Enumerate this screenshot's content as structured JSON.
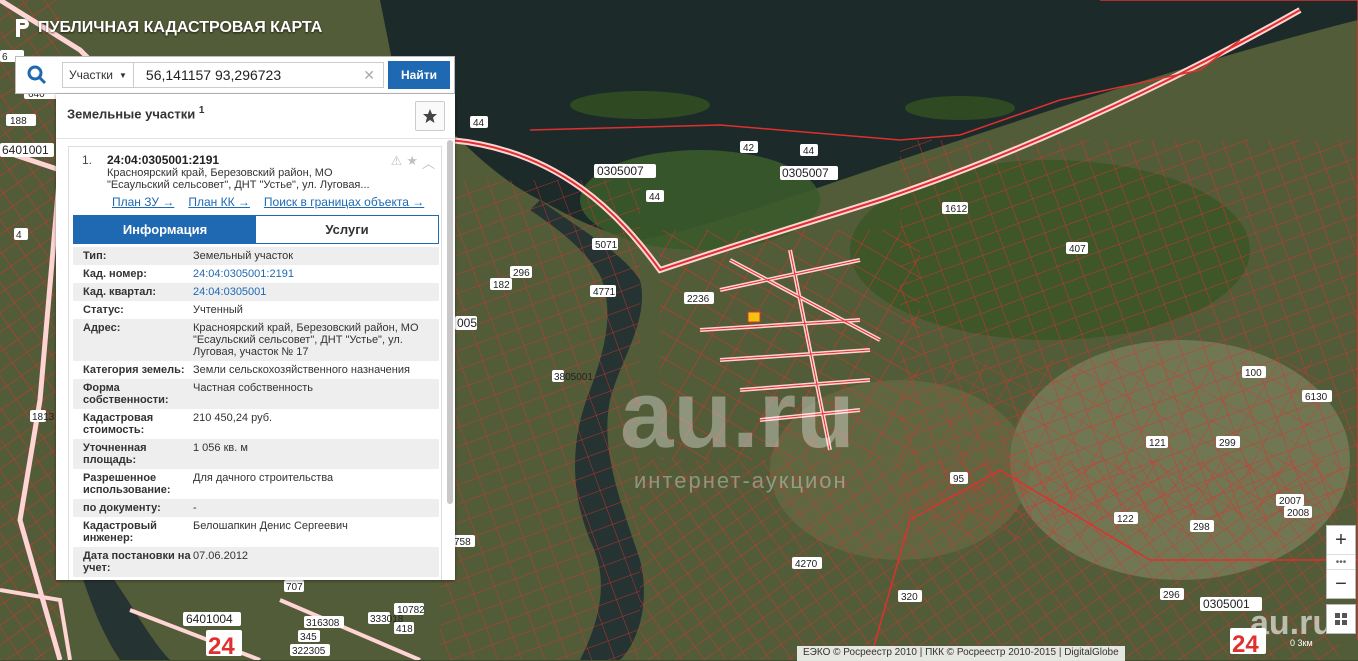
{
  "header": {
    "title": "ПУБЛИЧНАЯ КАДАСТРОВАЯ КАРТА"
  },
  "search": {
    "type_label": "Участки",
    "value": "56,141157 93,296723",
    "find_label": "Найти"
  },
  "panel": {
    "title": "Земельные участки",
    "count": "1",
    "item": {
      "index": "1.",
      "cad_number": "24:04:0305001:2191",
      "address": "Красноярский край, Березовский район, МО \"Есаульский сельсовет\", ДНТ \"Устье\", ул. Луговая...",
      "links": [
        "План ЗУ →",
        "План КК →",
        "Поиск в границах объекта →"
      ],
      "tabs": [
        "Информация",
        "Услуги"
      ],
      "rows": [
        {
          "k": "Тип:",
          "v": "Земельный участок"
        },
        {
          "k": "Кад. номер:",
          "v": "24:04:0305001:2191",
          "link": true
        },
        {
          "k": "Кад. квартал:",
          "v": "24:04:0305001",
          "link": true
        },
        {
          "k": "Статус:",
          "v": "Учтенный"
        },
        {
          "k": "Адрес:",
          "v": "Красноярский край, Березовский район, МО \"Есаульский сельсовет\", ДНТ \"Устье\", ул. Луговая, участок № 17"
        },
        {
          "k": "Категория земель:",
          "v": "Земли сельскохозяйственного назначения"
        },
        {
          "k": "Форма собственности:",
          "v": "Частная собственность"
        },
        {
          "k": "Кадастровая стоимость:",
          "v": "210 450,24 руб."
        },
        {
          "k": "Уточненная площадь:",
          "v": "1 056 кв. м"
        },
        {
          "k": "Разрешенное использование:",
          "v": "Для дачного строительства"
        },
        {
          "k": "по документу:",
          "v": "-"
        },
        {
          "k": "Кадастровый инженер:",
          "v": "Белошапкин Денис Сергеевич"
        },
        {
          "k": "Дата постановки на учет:",
          "v": "07.06.2012"
        }
      ]
    }
  },
  "map_labels": [
    "6401001",
    "188",
    "640",
    "3805001",
    "6",
    "1813",
    "4",
    "0305007",
    "0305007",
    "42",
    "44",
    "44",
    "44",
    "1612",
    "5071",
    "4771",
    "296",
    "182",
    "2236",
    "005",
    "407",
    "100",
    "6130",
    "121",
    "299",
    "95",
    "122",
    "298",
    "2007",
    "2008",
    "4270",
    "320",
    "296",
    "0305001",
    "758",
    "707",
    "10782",
    "6401004",
    "24",
    "316308",
    "345",
    "322305",
    "333018",
    "418",
    "24"
  ],
  "attribution": "ЕЭКО © Росреестр 2010 | ПКК © Росреестр 2010-2015 | DigitalGlobe",
  "scale": "0 3км",
  "watermark": {
    "main": "au.ru",
    "sub": "интернет-аукцион",
    "corner": "au.ru"
  },
  "colors": {
    "accent": "#1f69b2",
    "parcel": "#ff2a2a"
  }
}
